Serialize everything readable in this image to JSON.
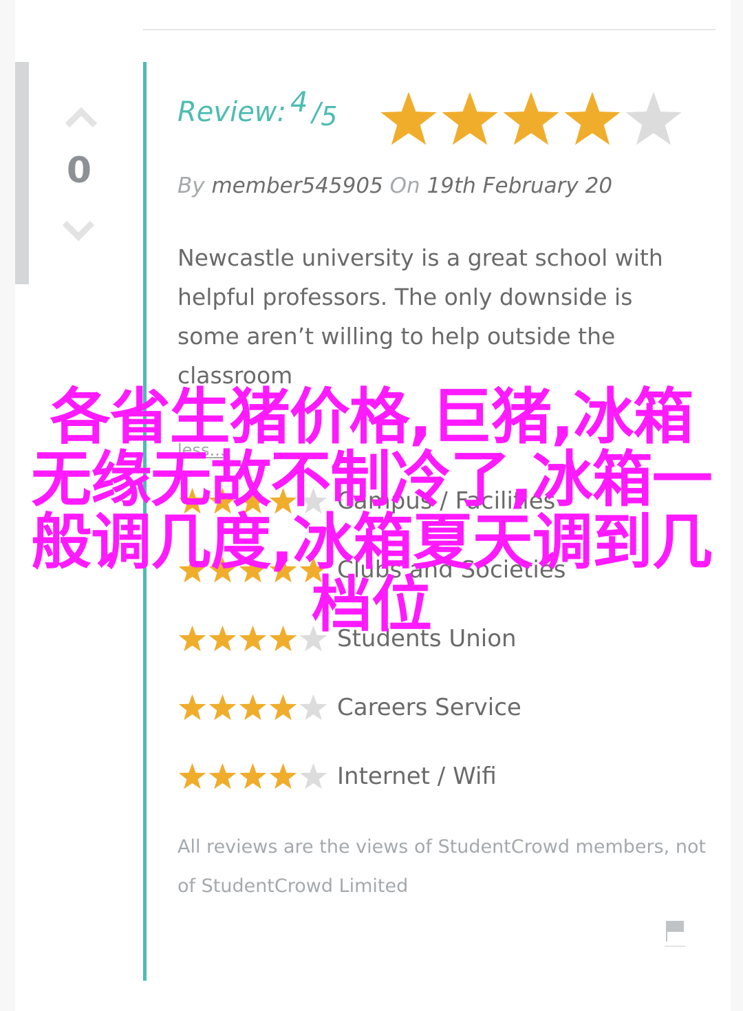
{
  "vote": {
    "count": "0"
  },
  "review": {
    "label": "Review:",
    "score": "4",
    "slash": "/",
    "out_of": "5",
    "rating": 4,
    "max_rating": 5
  },
  "byline": {
    "by_word": "By",
    "author": "member545905",
    "on_word": "On",
    "date": "19th February 20"
  },
  "body_text": "Newcastle university is a great school with helpful professors. The only downside is some aren’t willing to help outside the classroom",
  "less_link": "less...",
  "categories": [
    {
      "label": "Campus / Facilities",
      "rating": 4
    },
    {
      "label": "Clubs and Societies",
      "rating": 5
    },
    {
      "label": "Students Union",
      "rating": 4
    },
    {
      "label": "Careers Service",
      "rating": 4
    },
    {
      "label": "Internet / Wifi",
      "rating": 4
    }
  ],
  "disclaimer": "All reviews are the views of StudentCrowd members, not of StudentCrowd Limited",
  "overlay_text": "各省生猪价格,巨猪,冰箱无缘无故不制冷了,冰箱一般调几度,冰箱夏天调到几档位",
  "colors": {
    "accent": "#4dbcb1",
    "star_filled": "#f0ad2c",
    "star_empty": "#dcdcdc",
    "overlay": "#ff1aff"
  }
}
